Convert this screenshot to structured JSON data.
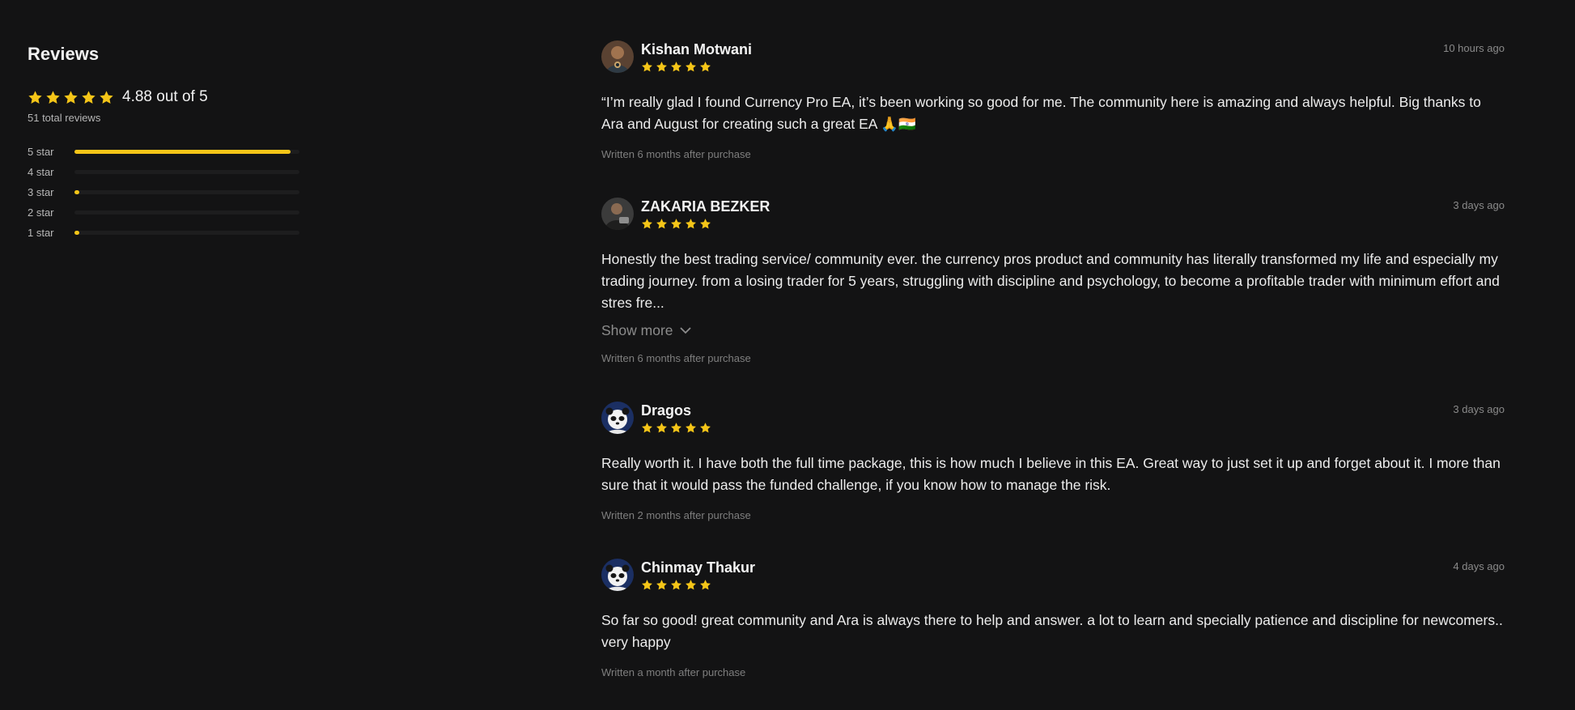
{
  "summary": {
    "title": "Reviews",
    "average_text": "4.88 out of 5",
    "average_rating": 4.88,
    "total_text": "51 total reviews",
    "star_color": "#f5c518",
    "breakdown": [
      {
        "label": "5 star",
        "fraction": 0.96
      },
      {
        "label": "4 star",
        "fraction": 0
      },
      {
        "label": "3 star",
        "fraction": 0.02
      },
      {
        "label": "2 star",
        "fraction": 0
      },
      {
        "label": "1 star",
        "fraction": 0.02
      }
    ]
  },
  "reviews": [
    {
      "name": "Kishan Motwani",
      "rating": 5,
      "when": "10 hours ago",
      "body": "“I’m really glad I found Currency Pro EA, it’s been working so good for me. The community here is amazing and always helpful. Big thanks to Ara and August for creating such a great EA 🙏🇮🇳",
      "written": "Written 6 months after purchase",
      "avatar": "photo-avatar"
    },
    {
      "name": "ZAKARIA BEZKER",
      "rating": 5,
      "when": "3 days ago",
      "body": "Honestly the best trading service/ community ever. the currency pros product and community has literally transformed my life and especially my trading journey. from a losing trader for 5 years, struggling with discipline and psychology, to become a profitable trader with minimum effort and stres fre...",
      "show_more": "Show more",
      "written": "Written 6 months after purchase",
      "avatar": "photo-avatar"
    },
    {
      "name": "Dragos",
      "rating": 5,
      "when": "3 days ago",
      "body": "Really worth it. I have both the full time package, this is how much I believe in this EA. Great way to just set it up and forget about it. I more than sure that it would pass the funded challenge, if you know how to manage the risk.",
      "written": "Written 2 months after purchase",
      "avatar": "panda-avatar"
    },
    {
      "name": "Chinmay Thakur",
      "rating": 5,
      "when": "4 days ago",
      "body": "So far so good! great community and Ara is always there to help and answer. a lot to learn and specially patience and discipline for newcomers.. very happy",
      "written": "Written a month after purchase",
      "avatar": "panda-avatar"
    }
  ]
}
